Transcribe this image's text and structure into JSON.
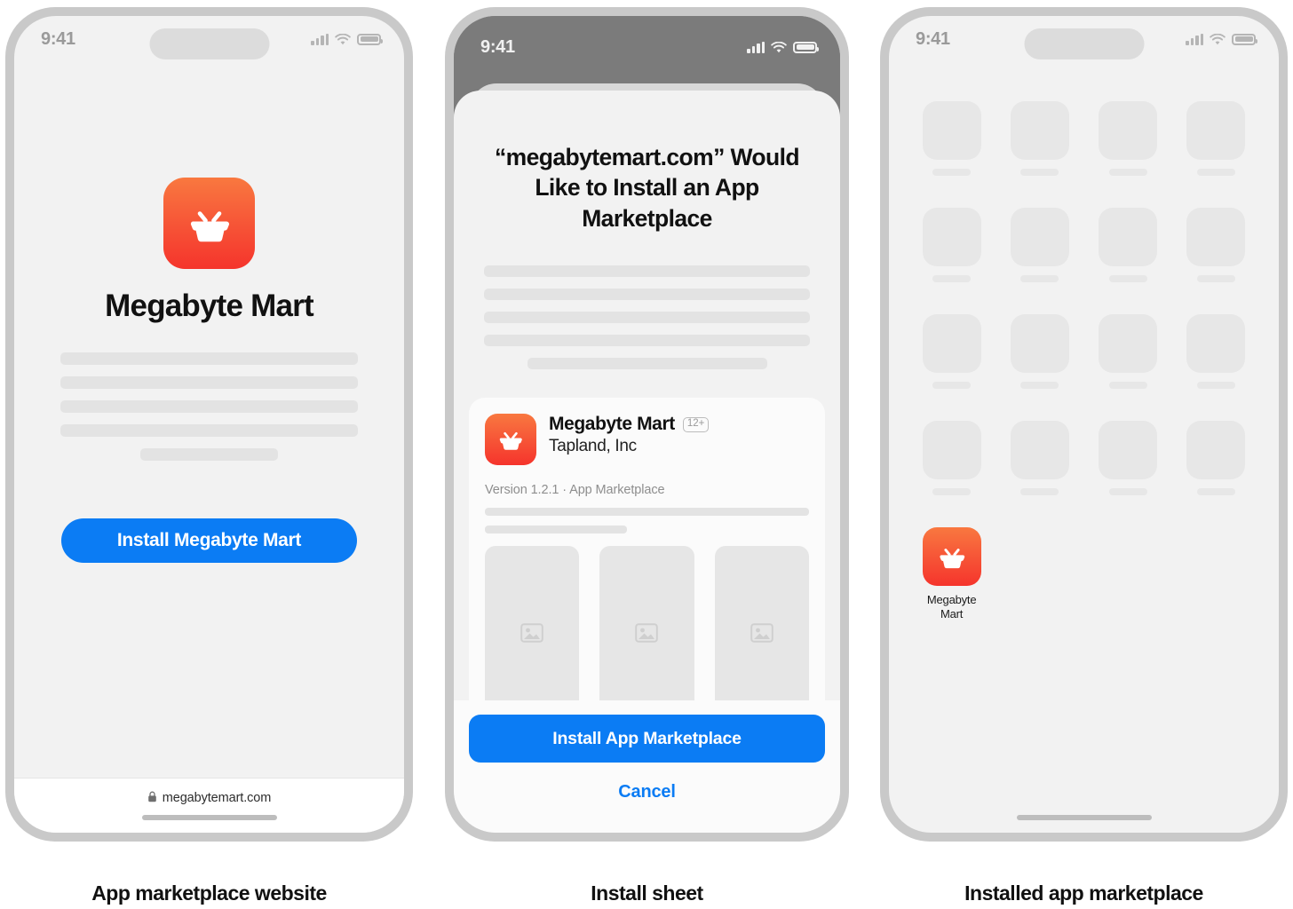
{
  "phones": [
    {
      "id": "website",
      "caption": "App marketplace website",
      "status": {
        "time": "9:41",
        "signal": "cellular-bars-icon",
        "wifi": "wifi-icon",
        "battery": "battery-icon"
      },
      "app_icon": "shopping-basket-icon",
      "title": "Megabyte Mart",
      "install_button": "Install Megabyte Mart",
      "url": "megabytemart.com",
      "url_lock": "lock-icon",
      "skeleton_lines": 4
    },
    {
      "id": "install-sheet",
      "caption": "Install sheet",
      "status": {
        "time": "9:41",
        "signal": "cellular-bars-icon",
        "wifi": "wifi-icon",
        "battery": "battery-icon"
      },
      "sheet_title": "“megabytemart.com” Would Like to Install an App Marketplace",
      "app": {
        "icon": "shopping-basket-icon",
        "name": "Megabyte Mart",
        "age_rating": "12+",
        "developer": "Tapland, Inc",
        "version_line": "Version 1.2.1 · App Marketplace",
        "screenshot_placeholders": 3,
        "screenshot_icon": "image-placeholder-icon"
      },
      "primary_button": "Install App Marketplace",
      "cancel_button": "Cancel",
      "description_lines": 4
    },
    {
      "id": "installed",
      "caption": "Installed app marketplace",
      "status": {
        "time": "9:41",
        "signal": "cellular-bars-icon",
        "wifi": "wifi-icon",
        "battery": "battery-icon"
      },
      "grid_rows": 4,
      "grid_cols": 4,
      "installed_app": {
        "icon": "shopping-basket-icon",
        "label_line1": "Megabyte",
        "label_line2": "Mart"
      }
    }
  ],
  "colors": {
    "accent_blue": "#0b7cf4",
    "icon_gradient_top": "#f9783f",
    "icon_gradient_bottom": "#f5342c",
    "frame": "#c9c9c9",
    "screen_bg": "#f2f2f2",
    "skeleton": "#e3e3e3",
    "dim_overlay": "#7b7b7b"
  }
}
